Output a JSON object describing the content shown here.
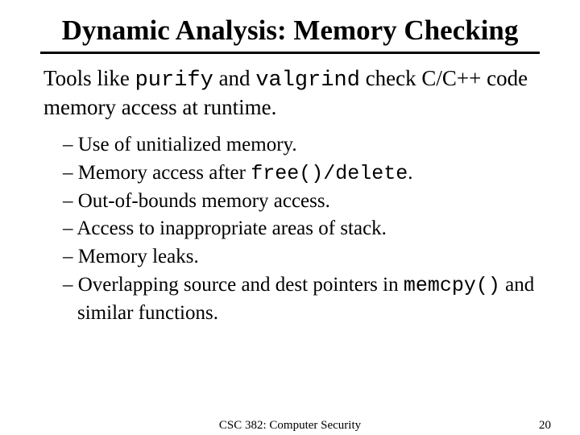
{
  "title": "Dynamic Analysis: Memory Checking",
  "lead": {
    "pre": "Tools like ",
    "tool1": "purify",
    "mid1": " and ",
    "tool2": "valgrind",
    "mid2": " check C/C++ code memory access at runtime."
  },
  "bullets": [
    {
      "before": "Use of unitialized memory.",
      "code": "",
      "after": ""
    },
    {
      "before": "Memory access after ",
      "code": "free()/delete",
      "after": "."
    },
    {
      "before": "Out-of-bounds memory access.",
      "code": "",
      "after": ""
    },
    {
      "before": "Access to inappropriate areas of stack.",
      "code": "",
      "after": ""
    },
    {
      "before": "Memory leaks.",
      "code": "",
      "after": ""
    },
    {
      "before": "Overlapping source and dest pointers in ",
      "code": "memcpy()",
      "after": " and similar functions."
    }
  ],
  "footer": {
    "course": "CSC 382: Computer Security",
    "page": "20"
  }
}
